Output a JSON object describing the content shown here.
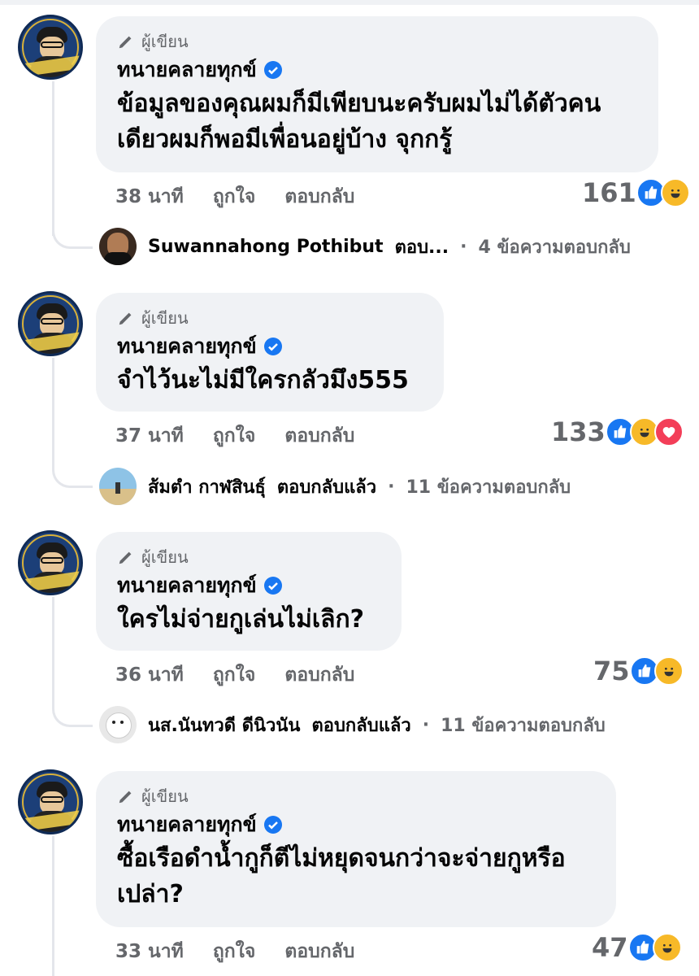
{
  "comments": [
    {
      "author_badge": "ผู้เขียน",
      "name": "ทนายคลายทุกข์",
      "lines": [
        "ข้อมูลของคุณผมก็มีเพียบนะครับผมไม่ได้ตัวคน",
        "เดียวผมก็พอมีเพื่อนอยู่บ้าง จุกกรู้"
      ],
      "time": "38 นาที",
      "like": "ถูกใจ",
      "reply": "ตอบกลับ",
      "count": "161",
      "reactions": [
        "like",
        "haha"
      ],
      "reply_summary": {
        "name": "Suwannahong Pothibut",
        "action": "ตอบ...",
        "count_text": "4 ข้อความตอบกลับ"
      }
    },
    {
      "author_badge": "ผู้เขียน",
      "name": "ทนายคลายทุกข์",
      "lines": [
        "จำไว้นะไม่มีใครกลัวมึง555"
      ],
      "time": "37 นาที",
      "like": "ถูกใจ",
      "reply": "ตอบกลับ",
      "count": "133",
      "reactions": [
        "like",
        "haha",
        "love"
      ],
      "reply_summary": {
        "name": "ส้มตำ กาฬสินธุ์",
        "action": "ตอบกลับแล้ว",
        "count_text": "11 ข้อความตอบกลับ"
      }
    },
    {
      "author_badge": "ผู้เขียน",
      "name": "ทนายคลายทุกข์",
      "lines": [
        "ใครไม่จ่ายกูเล่นไม่เลิก?"
      ],
      "time": "36 นาที",
      "like": "ถูกใจ",
      "reply": "ตอบกลับ",
      "count": "75",
      "reactions": [
        "like",
        "haha"
      ],
      "reply_summary": {
        "name": "นส.นันทวดี ดีนิวนัน",
        "action": "ตอบกลับแล้ว",
        "count_text": "11 ข้อความตอบกลับ"
      }
    },
    {
      "author_badge": "ผู้เขียน",
      "name": "ทนายคลายทุกข์",
      "lines": [
        "ซื้อเรือดำน้ำกูก็ตีไม่หยุดจนกว่าจะจ่ายกูหรือ",
        "เปล่า?"
      ],
      "time": "33 นาที",
      "like": "ถูกใจ",
      "reply": "ตอบกลับ",
      "count": "47",
      "reactions": [
        "like",
        "haha"
      ]
    }
  ],
  "colors": {
    "bubble": "#f0f2f5",
    "meta": "#65676b",
    "verified": "#1877f2"
  }
}
